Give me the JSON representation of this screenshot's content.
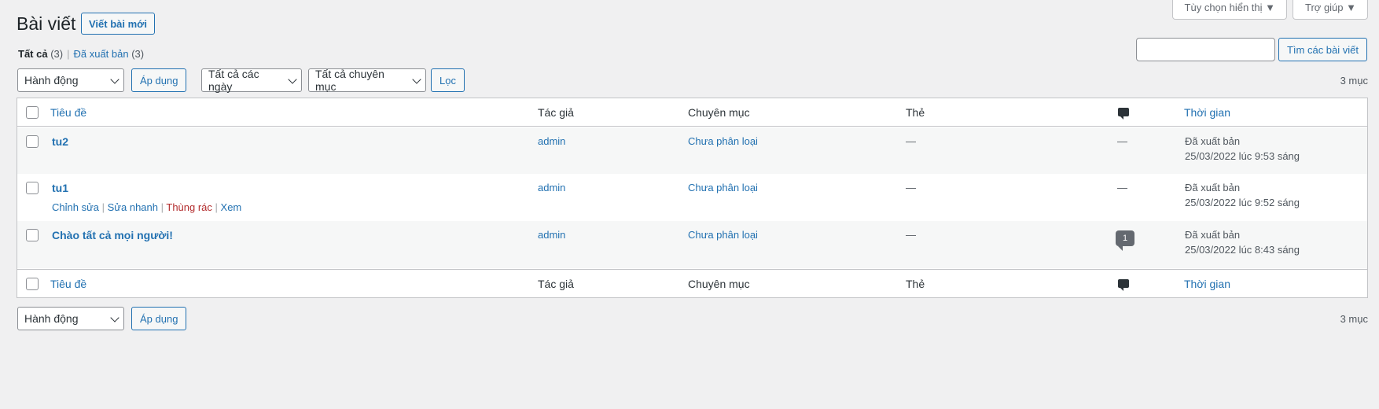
{
  "screen_meta": {
    "screen_options": "Tùy chọn hiển thị ▼",
    "help": "Trợ giúp ▼"
  },
  "header": {
    "title": "Bài viết",
    "add_new": "Viết bài mới"
  },
  "views": {
    "all_label": "Tất cả",
    "all_count": "(3)",
    "separator": "|",
    "published_label": "Đã xuất bản",
    "published_count": "(3)"
  },
  "search": {
    "value": "",
    "button": "Tìm các bài viết"
  },
  "tablenav_top": {
    "bulk_action": "Hành động",
    "apply": "Áp dụng",
    "date_filter": "Tất cả các ngày",
    "category_filter": "Tất cả chuyên mục",
    "filter_button": "Lọc",
    "items_count": "3 mục"
  },
  "table": {
    "columns": {
      "title": "Tiêu đề",
      "author": "Tác giả",
      "categories": "Chuyên mục",
      "tags": "Thẻ",
      "comments_icon": "comment-icon",
      "date": "Thời gian"
    },
    "rows": [
      {
        "title": "tu2",
        "author": "admin",
        "category": "Chưa phân loại",
        "tags": "—",
        "comments": "—",
        "status": "Đã xuất bản",
        "date": "25/03/2022 lúc 9:53 sáng"
      },
      {
        "title": "tu1",
        "author": "admin",
        "category": "Chưa phân loại",
        "tags": "—",
        "comments": "—",
        "status": "Đã xuất bản",
        "date": "25/03/2022 lúc 9:52 sáng",
        "actions": {
          "edit": "Chỉnh sửa",
          "quick_edit": "Sửa nhanh",
          "trash": "Thùng rác",
          "view": "Xem",
          "sep": " | "
        }
      },
      {
        "title": "Chào tất cả mọi người!",
        "author": "admin",
        "category": "Chưa phân loại",
        "tags": "—",
        "comments": "1",
        "status": "Đã xuất bản",
        "date": "25/03/2022 lúc 8:43 sáng"
      }
    ]
  },
  "tablenav_bottom": {
    "bulk_action": "Hành động",
    "apply": "Áp dụng",
    "items_count": "3 mục"
  },
  "colors": {
    "accent": "#2271b1",
    "background": "#f0f0f1",
    "trash": "#b32d2e"
  }
}
